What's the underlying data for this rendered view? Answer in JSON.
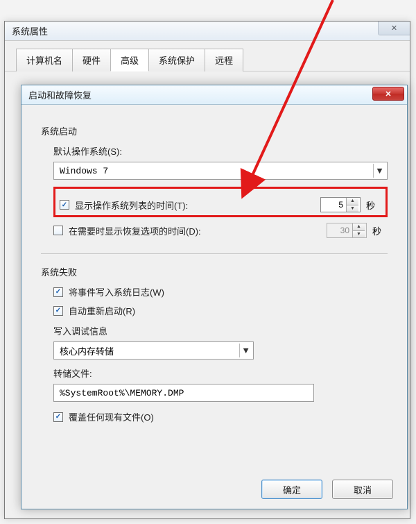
{
  "parent_window": {
    "title": "系统属性",
    "tabs": [
      "计算机名",
      "硬件",
      "高级",
      "系统保护",
      "远程"
    ],
    "active_tab_index": 2
  },
  "dialog": {
    "title": "启动和故障恢复",
    "section1": {
      "title": "系统启动",
      "default_os_label": "默认操作系统(S):",
      "default_os_value": "Windows 7",
      "show_os_list": {
        "checked": true,
        "label": "显示操作系统列表的时间(T):",
        "value": "5",
        "unit": "秒"
      },
      "show_recovery": {
        "checked": false,
        "label": "在需要时显示恢复选项的时间(D):",
        "value": "30",
        "unit": "秒"
      }
    },
    "section2": {
      "title": "系统失败",
      "write_event": {
        "checked": true,
        "label": "将事件写入系统日志(W)"
      },
      "auto_restart": {
        "checked": true,
        "label": "自动重新启动(R)"
      },
      "debug_label": "写入调试信息",
      "debug_select": "核心内存转储",
      "dump_file_label": "转储文件:",
      "dump_file_value": "%SystemRoot%\\MEMORY.DMP",
      "overwrite": {
        "checked": true,
        "label": "覆盖任何现有文件(O)"
      }
    },
    "buttons": {
      "ok": "确定",
      "cancel": "取消"
    }
  }
}
